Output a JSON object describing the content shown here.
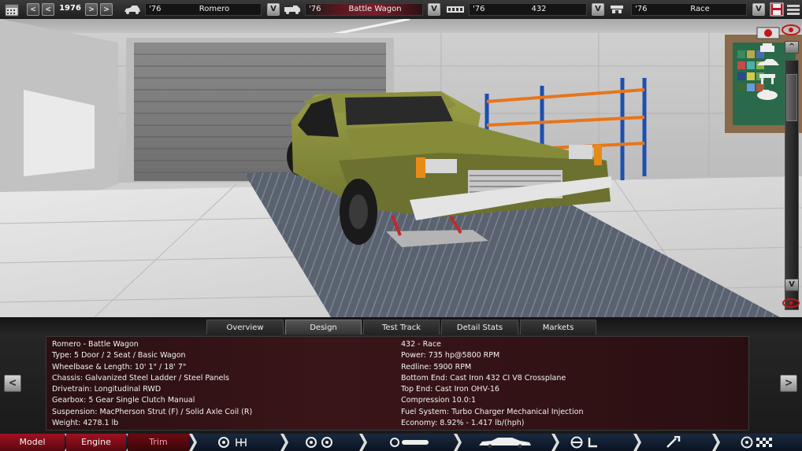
{
  "topbar": {
    "prev_fast": "<",
    "prev": "<",
    "year": "1976",
    "next": ">",
    "next_fast": ">",
    "model": {
      "year": "'76",
      "name": "Romero"
    },
    "trim": {
      "year": "'76",
      "name": "Battle Wagon"
    },
    "engine": {
      "year": "'76",
      "name": "432"
    },
    "variant": {
      "year": "'76",
      "name": "Race"
    },
    "dropdown_label": "V"
  },
  "side": {
    "scroll_up": "^",
    "scroll_down": "V"
  },
  "tabs": [
    {
      "label": "Overview",
      "active": false
    },
    {
      "label": "Design",
      "active": true
    },
    {
      "label": "Test Track",
      "active": false
    },
    {
      "label": "Detail Stats",
      "active": false
    },
    {
      "label": "Markets",
      "active": false
    }
  ],
  "info": {
    "left": [
      "Romero - Battle Wagon",
      "Type: 5 Door / 2 Seat / Basic Wagon",
      "Wheelbase & Length: 10' 1\" / 18' 7\"",
      "Chassis: Galvanized Steel Ladder / Steel Panels",
      "Drivetrain: Longitudinal RWD",
      "Gearbox: 5 Gear Single Clutch Manual",
      "Suspension: MacPherson Strut (F) / Solid Axle Coil (R)",
      "Weight: 4278.1 lb"
    ],
    "right": [
      "432 - Race",
      "Power: 735 hp@5800 RPM",
      "Redline: 5900 RPM",
      "Bottom End: Cast Iron 432 CI V8 Crossplane",
      "Top End: Cast Iron OHV-16",
      "Compression 10.0:1",
      "Fuel System: Turbo Charger Mechanical Injection",
      "Economy: 8.92% - 1.417 lb/(hph)"
    ],
    "prev": "<",
    "next": ">"
  },
  "bottomnav": {
    "model": "Model",
    "engine": "Engine",
    "trim": "Trim"
  },
  "colors": {
    "car_body": "#8a8f3c",
    "accent_red": "#a01020",
    "nav_blue": "#0e1a2c"
  }
}
